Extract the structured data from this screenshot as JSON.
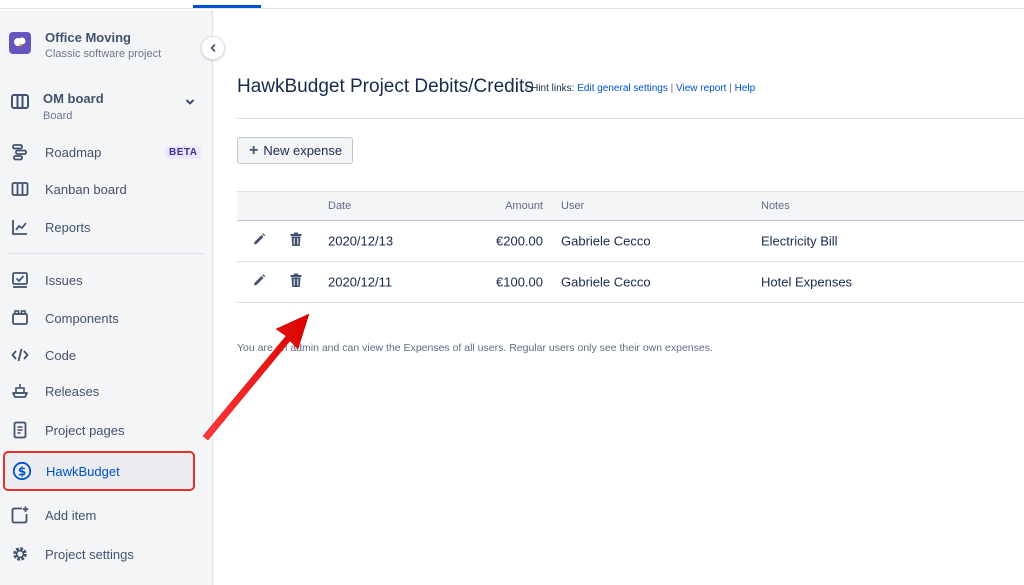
{
  "project": {
    "name": "Office Moving",
    "type": "Classic software project",
    "icon": "project-avatar-icon"
  },
  "board": {
    "name": "OM board",
    "sub": "Board"
  },
  "sidebar": {
    "items": [
      {
        "label": "Roadmap",
        "icon": "roadmap-icon",
        "badge": "BETA"
      },
      {
        "label": "Kanban board",
        "icon": "kanban-icon"
      },
      {
        "label": "Reports",
        "icon": "reports-icon"
      },
      {
        "label": "Issues",
        "icon": "issues-icon"
      },
      {
        "label": "Components",
        "icon": "components-icon"
      },
      {
        "label": "Code",
        "icon": "code-icon"
      },
      {
        "label": "Releases",
        "icon": "releases-icon"
      },
      {
        "label": "Project pages",
        "icon": "project-pages-icon"
      },
      {
        "label": "HawkBudget",
        "icon": "dollar-icon",
        "active": true
      },
      {
        "label": "Add item",
        "icon": "add-item-icon"
      },
      {
        "label": "Project settings",
        "icon": "gear-icon"
      }
    ]
  },
  "page": {
    "title": "HawkBudget Project Debits/Credits",
    "hint_prefix": "- Hint links:",
    "hint_links": [
      "Edit general settings",
      "View report",
      "Help"
    ],
    "new_expense_label": "New expense"
  },
  "table": {
    "headers": {
      "date": "Date",
      "amount": "Amount",
      "user": "User",
      "notes": "Notes"
    },
    "rows": [
      {
        "date": "2020/12/13",
        "amount": "€200.00",
        "user": "Gabriele Cecco",
        "notes": "Electricity Bill"
      },
      {
        "date": "2020/12/11",
        "amount": "€100.00",
        "user": "Gabriele Cecco",
        "notes": "Hotel Expenses"
      }
    ]
  },
  "footnote": "You are an admin and can view the Expenses of all users. Regular users only see their own expenses.",
  "colors": {
    "accent": "#0052cc",
    "highlight": "#e03131",
    "sidebar_bg": "#f4f5f7"
  }
}
